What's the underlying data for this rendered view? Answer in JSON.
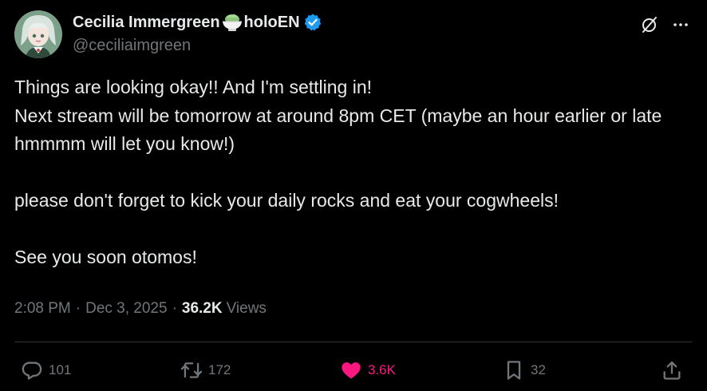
{
  "author": {
    "display_name_part1": "Cecilia Immergreen",
    "display_name_part2": "holoEN",
    "handle": "@ceciliaimgreen",
    "verified": true,
    "name_emoji": "matcha-bowl-icon",
    "avatar": "avatar-image"
  },
  "header_actions": {
    "grok_icon": "grok-icon",
    "more_icon": "more-icon"
  },
  "tweet": {
    "paragraphs": [
      "Things are looking okay!! And I'm settling in!\nNext stream will be tomorrow at around 8pm CET (maybe an hour earlier or late hmmmm will let you know!)",
      "please don't forget to kick your daily rocks and eat your cogwheels!",
      "See you soon otomos!"
    ]
  },
  "meta": {
    "time": "2:08 PM",
    "separator": "·",
    "date": "Dec 3, 2025",
    "views_count": "36.2K",
    "views_label": "Views"
  },
  "actions": {
    "reply_count": "101",
    "retweet_count": "172",
    "like_count": "3.6K",
    "bookmark_count": "32"
  },
  "colors": {
    "background": "#000000",
    "text": "#e7e9ea",
    "muted": "#71767b",
    "like": "#f91880",
    "verified": "#1d9bf0"
  }
}
